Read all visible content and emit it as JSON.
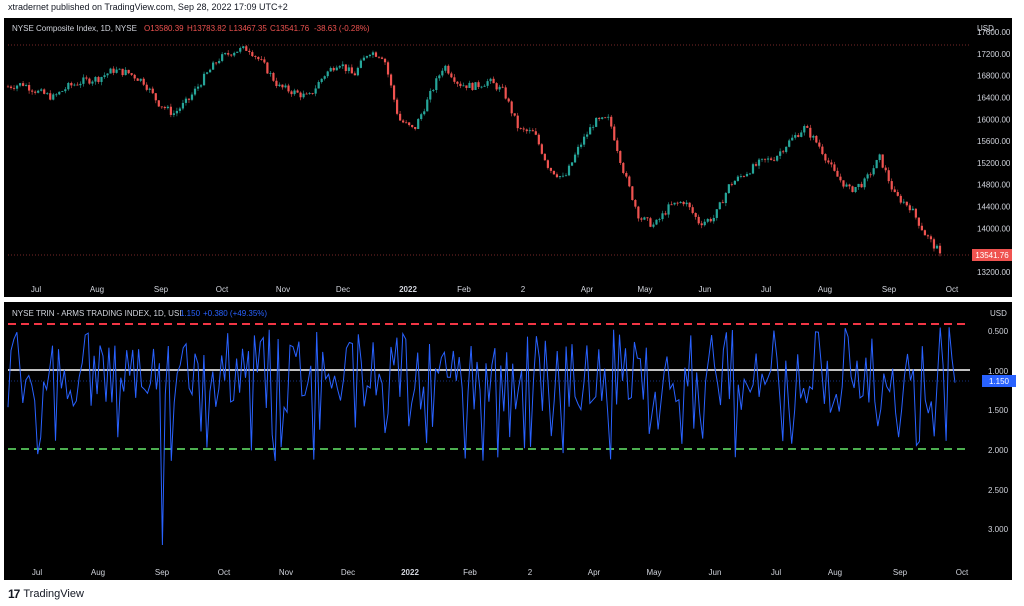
{
  "header": {
    "published": "xtradernet published on TradingView.com, Sep 28, 2022 17:09 UTC+2"
  },
  "footer": {
    "logo_icon": "tradingview-logo-icon",
    "brand": "TradingView"
  },
  "colors": {
    "up": "#26a69a",
    "down": "#ef5350",
    "trin_line": "#2962ff",
    "upper_band": "#f23645",
    "lower_band": "#4caf50",
    "mid_line": "#ffffff"
  },
  "chart_data": [
    {
      "type": "candlestick",
      "legend": {
        "symbol": "NYSE Composite Index, 1D, NYSE",
        "open": "O13580.39",
        "high": "H13783.82",
        "low": "L13467.35",
        "close": "C13541.76",
        "change": "-38.63 (-0.28%)"
      },
      "currency": "USD",
      "last_price_label": "13541.76",
      "ylim": [
        13000,
        17600
      ],
      "y_ticks": [
        "17600.00",
        "17200.00",
        "16800.00",
        "16400.00",
        "16000.00",
        "15600.00",
        "15200.00",
        "14800.00",
        "14400.00",
        "14000.00",
        "13200.00"
      ],
      "x_ticks": [
        "Jul",
        "Aug",
        "Sep",
        "Oct",
        "Nov",
        "Dec",
        "2022",
        "Feb",
        "2",
        "Apr",
        "May",
        "Jun",
        "Jul",
        "Aug",
        "Sep",
        "Oct"
      ],
      "range_high": 17350,
      "range_low": 13541.76,
      "closes_approx": [
        16600,
        16650,
        16500,
        16400,
        16600,
        16700,
        16750,
        16900,
        16850,
        16700,
        16300,
        16100,
        16350,
        16750,
        17100,
        17250,
        17300,
        17000,
        16600,
        16500,
        16400,
        16800,
        17050,
        16800,
        17250,
        17150,
        16000,
        15800,
        16400,
        17000,
        16650,
        16600,
        16700,
        16500,
        15800,
        15750,
        15100,
        14900,
        15500,
        15950,
        16000,
        15000,
        14200,
        14050,
        14400,
        14500,
        14100,
        14200,
        14800,
        15000,
        15200,
        15300,
        15600,
        15850,
        15500,
        15000,
        14700,
        14850,
        15300,
        14600,
        14400,
        13900,
        13541.76
      ]
    },
    {
      "type": "line",
      "legend": {
        "name": "NYSE TRIN - ARMS TRADING INDEX, 1D, USI",
        "value": "1.150",
        "change": "+0.380 (+49.35%)"
      },
      "currency": "USD",
      "inverted_axis": true,
      "ylim": [
        0.3,
        3.3
      ],
      "y_ticks": [
        "0.500",
        "1.000",
        "1.500",
        "2.000",
        "2.500",
        "3.000"
      ],
      "last_value_label": "1.150",
      "reference_lines": [
        0.55,
        1.0,
        2.0
      ],
      "x_ticks": [
        "Jul",
        "Aug",
        "Sep",
        "Oct",
        "Nov",
        "Dec",
        "2022",
        "Feb",
        "2",
        "Apr",
        "May",
        "Jun",
        "Jul",
        "Aug",
        "Sep",
        "Oct"
      ],
      "notable_values": {
        "max": 3.2,
        "min": 0.45,
        "last": 1.15
      }
    }
  ]
}
